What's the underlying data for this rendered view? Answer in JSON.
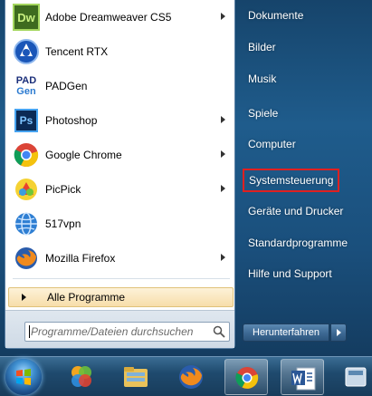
{
  "programs": [
    {
      "label": "Adobe Dreamweaver CS5",
      "icon": "dreamweaver-icon",
      "has_submenu": true
    },
    {
      "label": "Tencent RTX",
      "icon": "tencent-rtx-icon",
      "has_submenu": false
    },
    {
      "label": "PADGen",
      "icon": "padgen-icon",
      "has_submenu": false
    },
    {
      "label": "Photoshop",
      "icon": "photoshop-icon",
      "has_submenu": true
    },
    {
      "label": "Google Chrome",
      "icon": "chrome-icon",
      "has_submenu": true
    },
    {
      "label": "PicPick",
      "icon": "picpick-icon",
      "has_submenu": true
    },
    {
      "label": "517vpn",
      "icon": "vpn-icon",
      "has_submenu": false
    },
    {
      "label": "Mozilla Firefox",
      "icon": "firefox-icon",
      "has_submenu": true
    }
  ],
  "icon_text": {
    "dreamweaver": "Dw",
    "padgen_top": "PAD",
    "padgen_bottom": "Gen",
    "photoshop": "Ps"
  },
  "all_programs_label": "Alle Programme",
  "search": {
    "placeholder": "Programme/Dateien durchsuchen"
  },
  "right_items": [
    {
      "label": "Dokumente"
    },
    {
      "label": "Bilder"
    },
    {
      "label": "Musik"
    },
    {
      "label": "Spiele"
    },
    {
      "label": "Computer"
    },
    {
      "label": "Systemsteuerung",
      "highlighted": true
    },
    {
      "label": "Geräte und Drucker"
    },
    {
      "label": "Standardprogramme"
    },
    {
      "label": "Hilfe und Support"
    }
  ],
  "shutdown_label": "Herunterfahren",
  "taskbar": [
    {
      "name": "start-orb"
    },
    {
      "name": "taskbar-app-colorful",
      "icon": "colorful-circles-icon"
    },
    {
      "name": "taskbar-app-explorer",
      "icon": "folder-icon"
    },
    {
      "name": "taskbar-app-firefox",
      "icon": "firefox-icon"
    },
    {
      "name": "taskbar-app-chrome",
      "icon": "chrome-icon"
    },
    {
      "name": "taskbar-app-word",
      "icon": "word-icon"
    },
    {
      "name": "taskbar-app-partial",
      "icon": "app-icon"
    }
  ],
  "colors": {
    "highlight_border": "#e02020",
    "all_programs_bg": "#f7deaa",
    "menu_blue": "#1f5c8c"
  }
}
